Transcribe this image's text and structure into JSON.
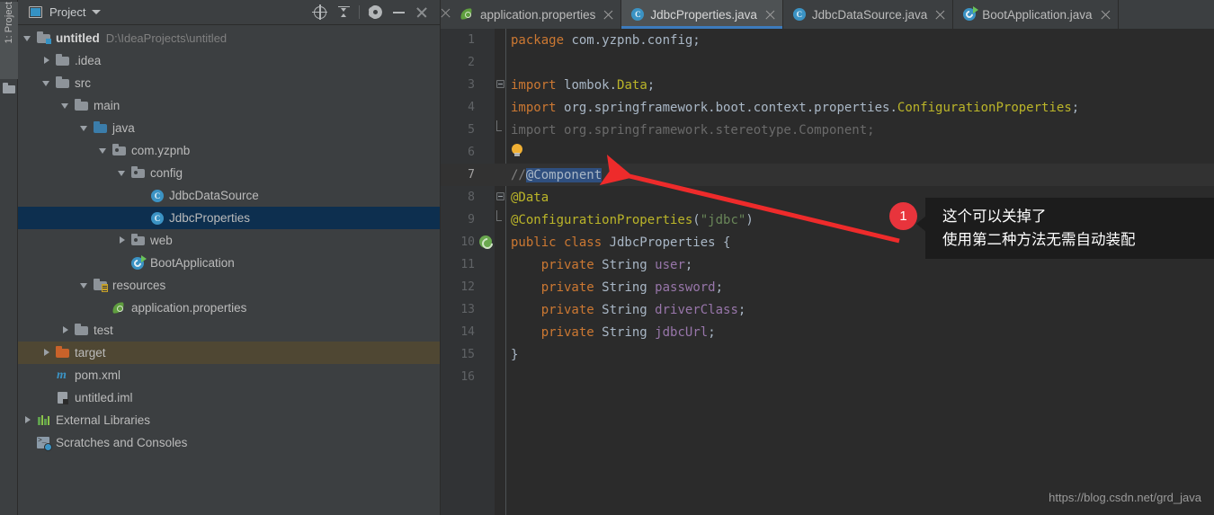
{
  "tool_strip": {
    "label": "1: Project",
    "folder_icon": "folder-icon"
  },
  "project_panel": {
    "title": "Project",
    "toolbar": {
      "locate": "locate-icon",
      "collapse_all": "collapse-all-icon",
      "settings": "gear-icon",
      "minimize": "minimize-icon",
      "close": "close-icon"
    },
    "tree": [
      {
        "label": "untitled",
        "path": "D:\\IdeaProjects\\untitled",
        "indent": 0,
        "twist": "open",
        "icon": "module-folder-icon",
        "bold": true,
        "state": "normal"
      },
      {
        "label": ".idea",
        "path": "",
        "indent": 1,
        "twist": "closed",
        "icon": "folder-icon",
        "bold": false,
        "state": "normal"
      },
      {
        "label": "src",
        "path": "",
        "indent": 1,
        "twist": "open",
        "icon": "folder-icon",
        "bold": false,
        "state": "normal"
      },
      {
        "label": "main",
        "path": "",
        "indent": 2,
        "twist": "open",
        "icon": "folder-icon",
        "bold": false,
        "state": "normal"
      },
      {
        "label": "java",
        "path": "",
        "indent": 3,
        "twist": "open",
        "icon": "source-folder-icon",
        "bold": false,
        "state": "normal"
      },
      {
        "label": "com.yzpnb",
        "path": "",
        "indent": 4,
        "twist": "open",
        "icon": "package-icon",
        "bold": false,
        "state": "normal"
      },
      {
        "label": "config",
        "path": "",
        "indent": 5,
        "twist": "open",
        "icon": "package-icon",
        "bold": false,
        "state": "normal"
      },
      {
        "label": "JdbcDataSource",
        "path": "",
        "indent": 6,
        "twist": "none",
        "icon": "java-class-icon",
        "bold": false,
        "state": "normal"
      },
      {
        "label": "JdbcProperties",
        "path": "",
        "indent": 6,
        "twist": "none",
        "icon": "java-class-icon",
        "bold": false,
        "state": "selected"
      },
      {
        "label": "web",
        "path": "",
        "indent": 5,
        "twist": "closed",
        "icon": "package-icon",
        "bold": false,
        "state": "normal"
      },
      {
        "label": "BootApplication",
        "path": "",
        "indent": 5,
        "twist": "none",
        "icon": "spring-run-class-icon",
        "bold": false,
        "state": "normal"
      },
      {
        "label": "resources",
        "path": "",
        "indent": 3,
        "twist": "open",
        "icon": "resources-folder-icon",
        "bold": false,
        "state": "normal"
      },
      {
        "label": "application.properties",
        "path": "",
        "indent": 4,
        "twist": "none",
        "icon": "spring-properties-icon",
        "bold": false,
        "state": "normal"
      },
      {
        "label": "test",
        "path": "",
        "indent": 2,
        "twist": "closed",
        "icon": "folder-icon",
        "bold": false,
        "state": "normal"
      },
      {
        "label": "target",
        "path": "",
        "indent": 1,
        "twist": "closed",
        "icon": "excluded-folder-icon",
        "bold": false,
        "state": "excluded"
      },
      {
        "label": "pom.xml",
        "path": "",
        "indent": 1,
        "twist": "none",
        "icon": "maven-icon",
        "bold": false,
        "state": "normal"
      },
      {
        "label": "untitled.iml",
        "path": "",
        "indent": 1,
        "twist": "none",
        "icon": "iml-file-icon",
        "bold": false,
        "state": "normal"
      },
      {
        "label": "External Libraries",
        "path": "",
        "indent": 0,
        "twist": "closed",
        "icon": "libraries-icon",
        "bold": false,
        "state": "normal"
      },
      {
        "label": "Scratches and Consoles",
        "path": "",
        "indent": 0,
        "twist": "none",
        "icon": "scratches-icon",
        "bold": false,
        "state": "normal"
      }
    ]
  },
  "editor": {
    "tabs": [
      {
        "label": "application.properties",
        "icon": "spring-properties-icon",
        "active": false
      },
      {
        "label": "JdbcProperties.java",
        "icon": "java-class-icon",
        "active": true
      },
      {
        "label": "JdbcDataSource.java",
        "icon": "java-class-icon",
        "active": false
      },
      {
        "label": "BootApplication.java",
        "icon": "spring-run-class-icon",
        "active": false
      }
    ],
    "lines": [
      {
        "n": "1",
        "gutter": "",
        "fold": "none",
        "tokens": [
          {
            "t": "package ",
            "c": "kw"
          },
          {
            "t": "com.yzpnb.config;",
            "c": "plain"
          }
        ]
      },
      {
        "n": "2",
        "gutter": "",
        "fold": "none",
        "tokens": []
      },
      {
        "n": "3",
        "gutter": "",
        "fold": "minus",
        "tokens": [
          {
            "t": "import ",
            "c": "kw"
          },
          {
            "t": "lombok.",
            "c": "plain"
          },
          {
            "t": "Data",
            "c": "static-f"
          },
          {
            "t": ";",
            "c": "plain"
          }
        ]
      },
      {
        "n": "4",
        "gutter": "",
        "fold": "none",
        "tokens": [
          {
            "t": "import ",
            "c": "kw"
          },
          {
            "t": "org.springframework.boot.context.properties.",
            "c": "plain"
          },
          {
            "t": "ConfigurationProperties",
            "c": "static-f"
          },
          {
            "t": ";",
            "c": "plain"
          }
        ]
      },
      {
        "n": "5",
        "gutter": "",
        "fold": "tail",
        "tokens": [
          {
            "t": "import org.springframework.stereotype.Component;",
            "c": "gray"
          }
        ]
      },
      {
        "n": "6",
        "gutter": "lightbulb",
        "fold": "none",
        "tokens": []
      },
      {
        "n": "7",
        "gutter": "",
        "fold": "none",
        "highlight": true,
        "tokens": [
          {
            "t": "//",
            "c": "cmt"
          },
          {
            "t": "@Component",
            "c": "sel"
          }
        ]
      },
      {
        "n": "8",
        "gutter": "",
        "fold": "minus",
        "tokens": [
          {
            "t": "@Data",
            "c": "ann"
          }
        ]
      },
      {
        "n": "9",
        "gutter": "",
        "fold": "tail",
        "tokens": [
          {
            "t": "@ConfigurationProperties",
            "c": "ann"
          },
          {
            "t": "(",
            "c": "paren"
          },
          {
            "t": "\"jdbc\"",
            "c": "str"
          },
          {
            "t": ")",
            "c": "paren"
          }
        ]
      },
      {
        "n": "10",
        "gutter": "spring-bean",
        "fold": "none",
        "tokens": [
          {
            "t": "public class ",
            "c": "kw"
          },
          {
            "t": "JdbcProperties",
            "c": "cls"
          },
          {
            "t": " {",
            "c": "plain"
          }
        ]
      },
      {
        "n": "11",
        "gutter": "",
        "fold": "none",
        "tokens": [
          {
            "t": "    private ",
            "c": "kw"
          },
          {
            "t": "String ",
            "c": "cls"
          },
          {
            "t": "user",
            "c": "field"
          },
          {
            "t": ";",
            "c": "plain"
          }
        ]
      },
      {
        "n": "12",
        "gutter": "",
        "fold": "none",
        "tokens": [
          {
            "t": "    private ",
            "c": "kw"
          },
          {
            "t": "String ",
            "c": "cls"
          },
          {
            "t": "password",
            "c": "field"
          },
          {
            "t": ";",
            "c": "plain"
          }
        ]
      },
      {
        "n": "13",
        "gutter": "",
        "fold": "none",
        "tokens": [
          {
            "t": "    private ",
            "c": "kw"
          },
          {
            "t": "String ",
            "c": "cls"
          },
          {
            "t": "driverClass",
            "c": "field"
          },
          {
            "t": ";",
            "c": "plain"
          }
        ]
      },
      {
        "n": "14",
        "gutter": "",
        "fold": "none",
        "tokens": [
          {
            "t": "    private ",
            "c": "kw"
          },
          {
            "t": "String ",
            "c": "cls"
          },
          {
            "t": "jdbcUrl",
            "c": "field"
          },
          {
            "t": ";",
            "c": "plain"
          }
        ]
      },
      {
        "n": "15",
        "gutter": "",
        "fold": "none",
        "tokens": [
          {
            "t": "}",
            "c": "plain"
          }
        ]
      },
      {
        "n": "16",
        "gutter": "",
        "fold": "none",
        "tokens": []
      }
    ],
    "watermark": "https://blog.csdn.net/grd_java"
  },
  "annotation": {
    "badge": "1",
    "line1": "这个可以关掉了",
    "line2": "使用第二种方法无需自动装配",
    "arrow_color": "#ee2b2b",
    "badge_color": "#e8343c",
    "box_color": "#1c1c1c"
  }
}
